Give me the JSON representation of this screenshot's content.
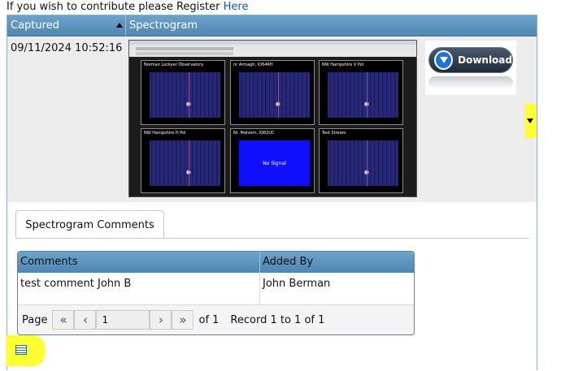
{
  "notice": {
    "text": "If you wish to contribute please Register",
    "link": "Here"
  },
  "grid": {
    "columns": [
      "Captured",
      "Spectrogram"
    ],
    "row": {
      "captured": "09/11/2024 10:52:16",
      "panels": [
        {
          "title": "Norman Lockyer Observatory"
        },
        {
          "title": "nr Armagh, IO64RH"
        },
        {
          "title": "NW Hampshire V Pol"
        },
        {
          "title": "NW Hampshire H Pol"
        },
        {
          "title": "Nr. Malvern, IO82UC",
          "overlay": "No Signal"
        },
        {
          "title": "Test Stream"
        }
      ],
      "download_label": "Download"
    }
  },
  "detail": {
    "tab_label": "Spectrogram Comments",
    "comments_grid": {
      "columns": [
        "Comments",
        "Added By"
      ],
      "rows": [
        {
          "comment": "test comment John B",
          "added_by": "John Berman"
        }
      ],
      "pager": {
        "page_label": "Page",
        "page_value": "1",
        "of_label": "of 1",
        "record_text": "Record 1 to 1 of 1"
      }
    }
  }
}
